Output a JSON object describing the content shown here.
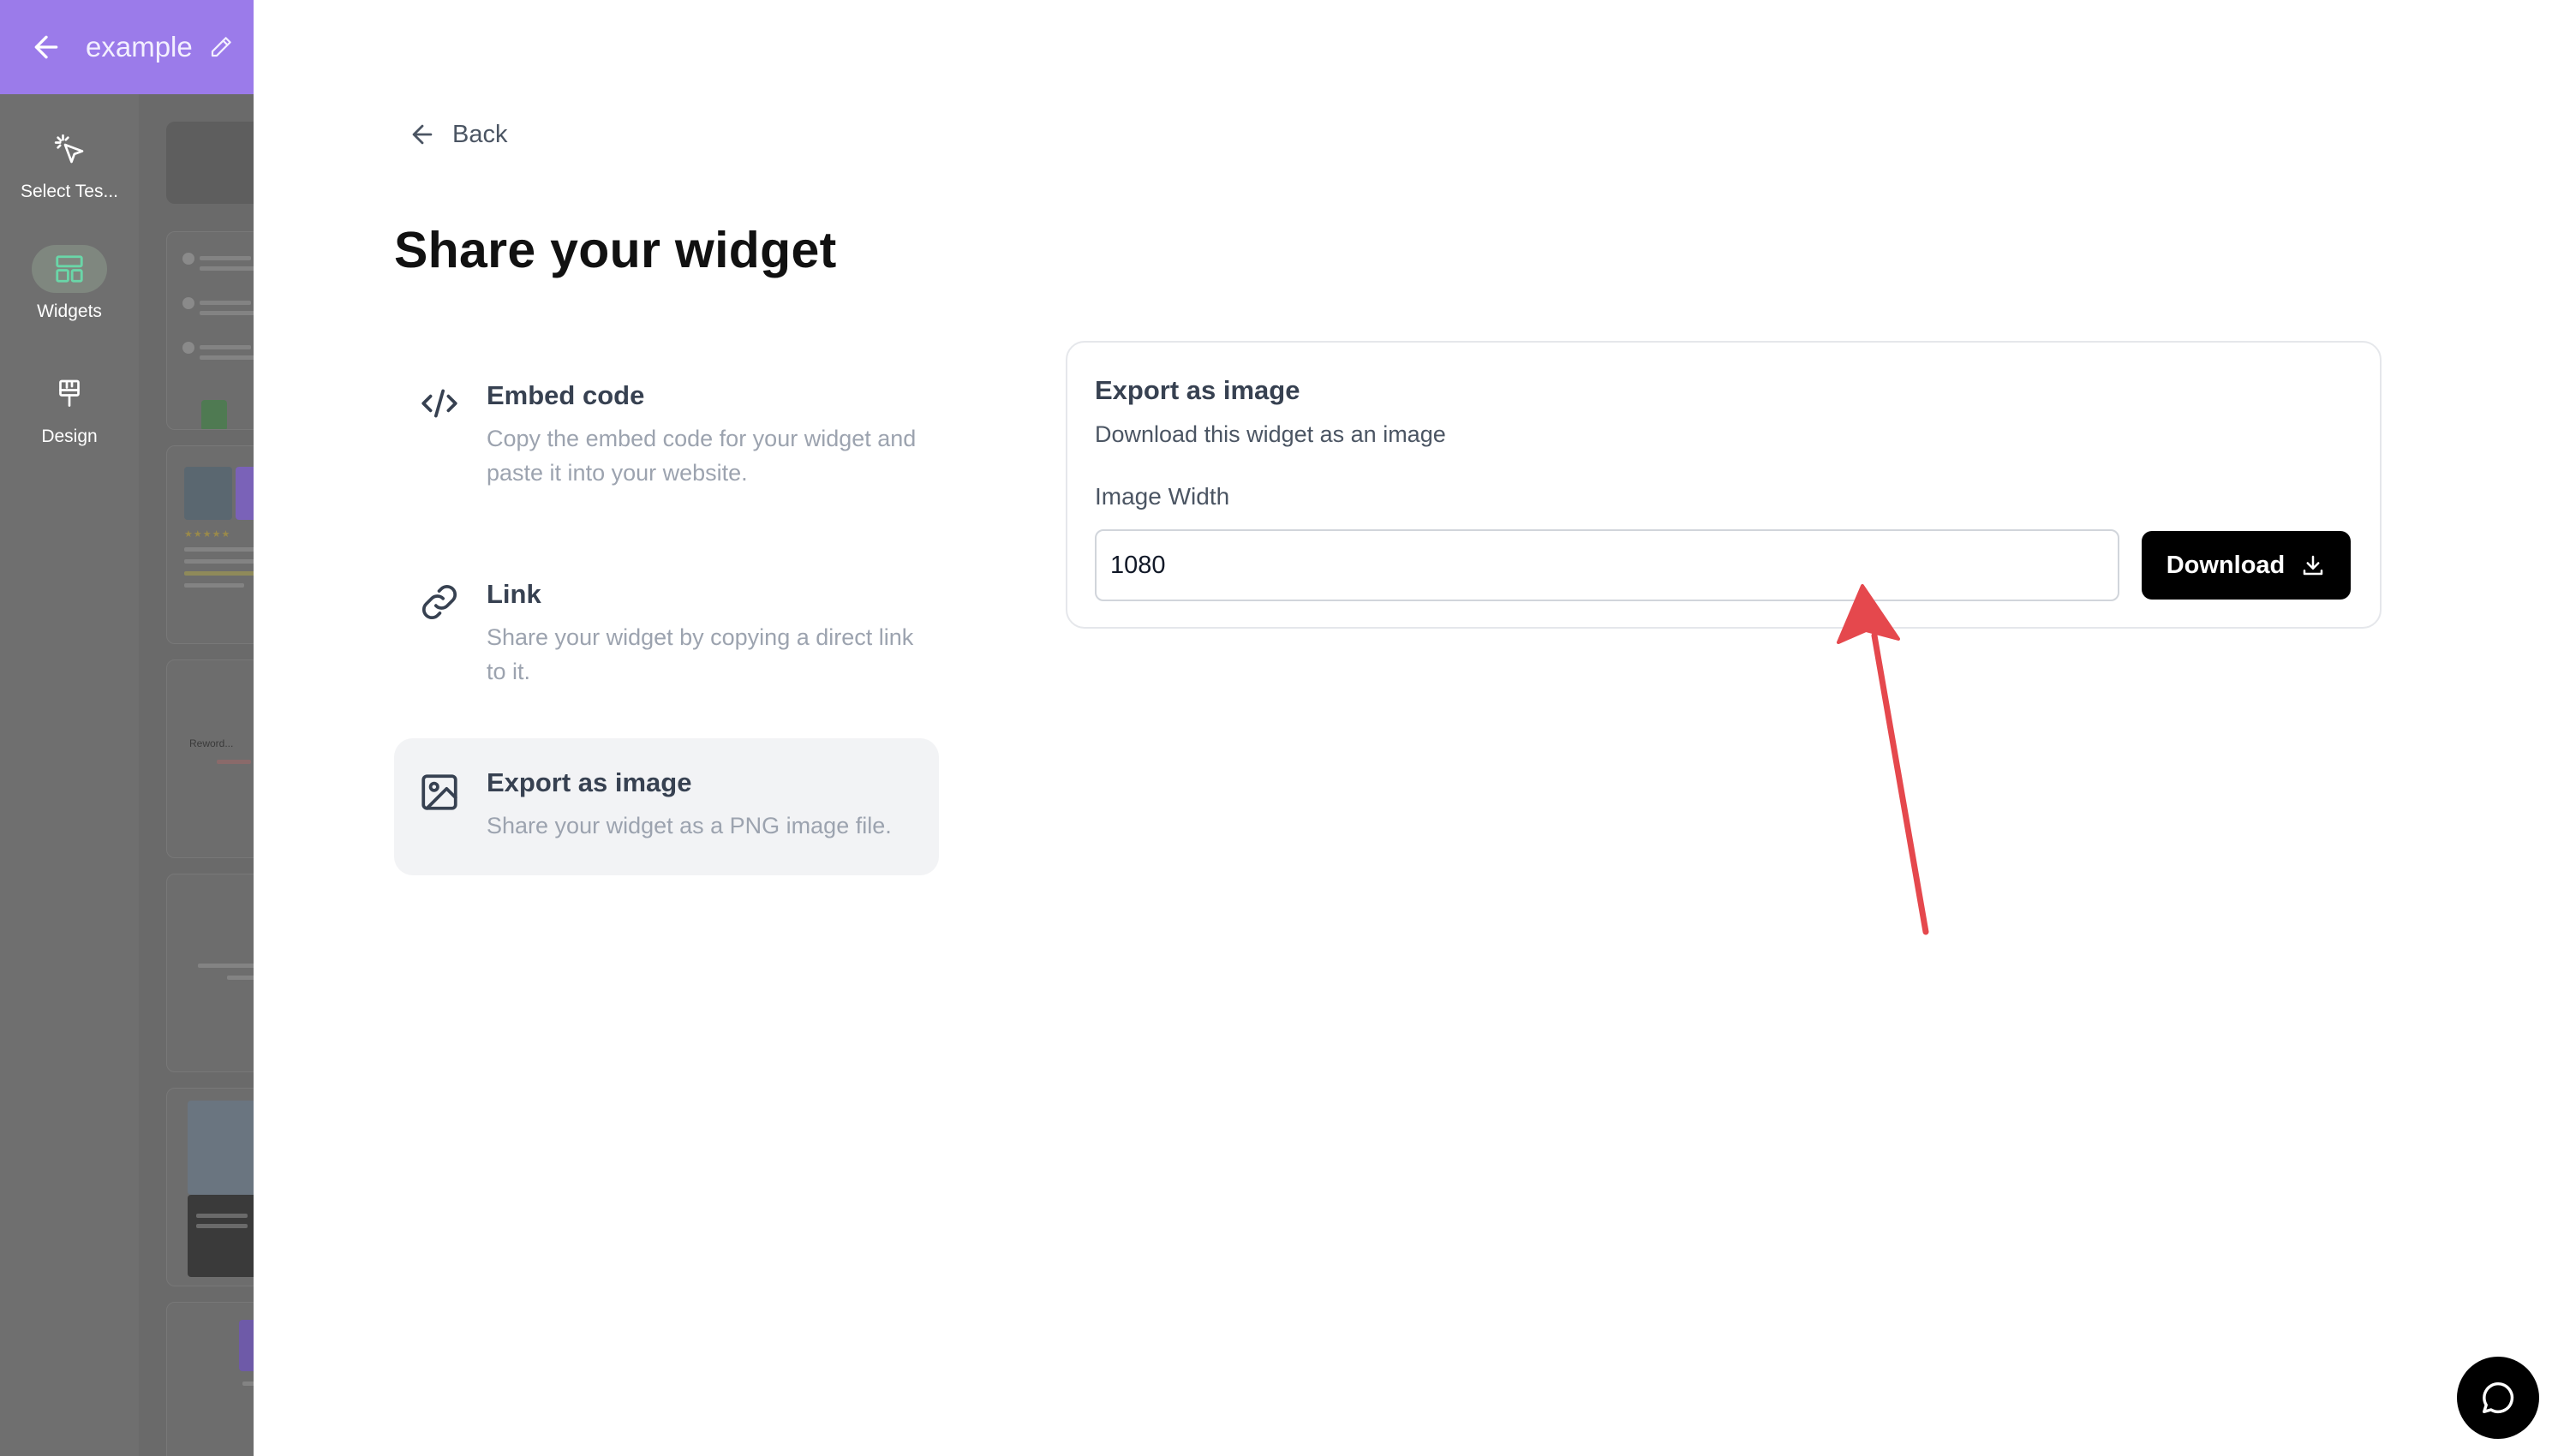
{
  "app": {
    "widget_name": "example"
  },
  "rail": {
    "items": [
      {
        "label": "Select Tes...",
        "icon": "pointer-click-icon",
        "active": false
      },
      {
        "label": "Widgets",
        "icon": "layout-icon",
        "active": true
      },
      {
        "label": "Design",
        "icon": "paint-brush-icon",
        "active": false
      }
    ]
  },
  "thumbs": {
    "labels": [
      "Reword..."
    ]
  },
  "drawer": {
    "back_label": "Back",
    "title": "Share your widget",
    "options": [
      {
        "title": "Embed code",
        "description": "Copy the embed code for your widget and paste it into your website.",
        "icon": "code-icon",
        "selected": false
      },
      {
        "title": "Link",
        "description": "Share your widget by copying a direct link to it.",
        "icon": "link-icon",
        "selected": false
      },
      {
        "title": "Export as image",
        "description": "Share your widget as a PNG image file.",
        "icon": "image-icon",
        "selected": true
      }
    ],
    "export_card": {
      "title": "Export as image",
      "subtitle": "Download this widget as an image",
      "width_label": "Image Width",
      "width_value": "1080",
      "download_label": "Download"
    }
  },
  "colors": {
    "brand": "#9b7bea",
    "annotation": "#e5484d",
    "button": "#000000"
  }
}
